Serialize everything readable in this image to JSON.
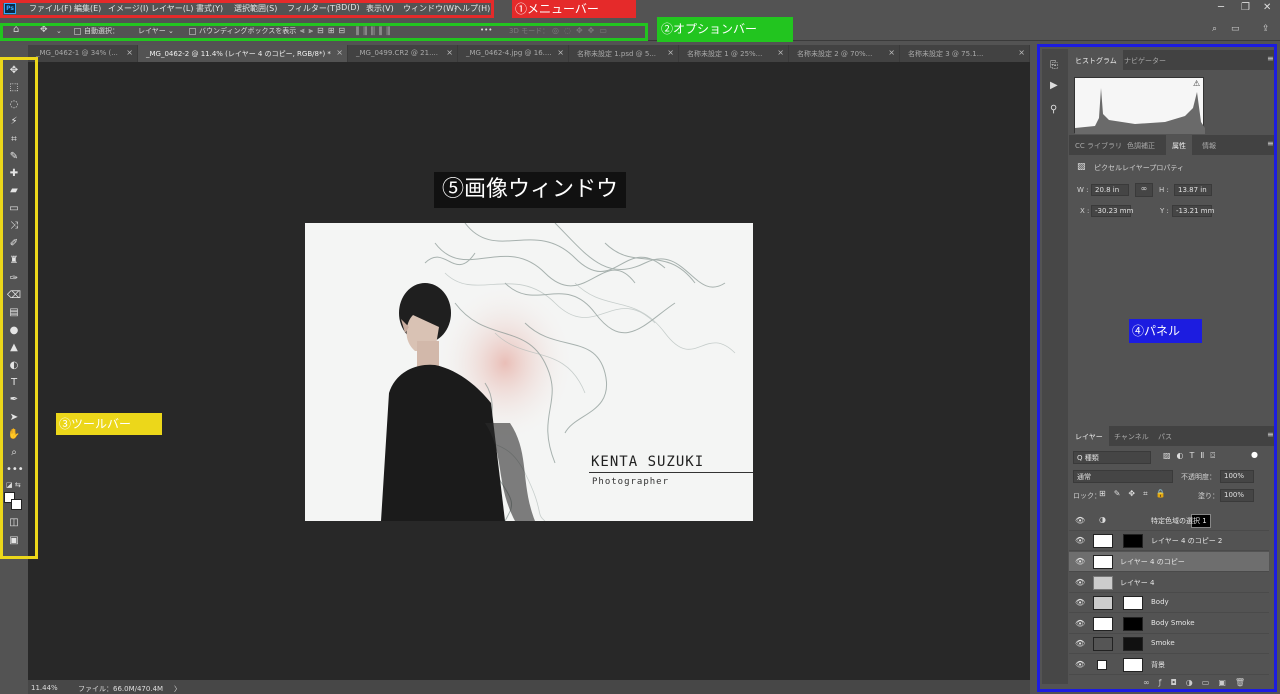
{
  "app_logo": "Ps",
  "menu": [
    "ファイル(F)",
    "編集(E)",
    "イメージ(I)",
    "レイヤー(L)",
    "書式(Y)",
    "選択範囲(S)",
    "フィルター(T)",
    "3D(D)",
    "表示(V)",
    "ウィンドウ(W)",
    "ヘルプ(H)"
  ],
  "window_controls": {
    "minimize": "─",
    "restore": "❐",
    "close": "✕"
  },
  "annotations": {
    "menu_bar": "①メニューバー",
    "option_bar": "②オプションバー",
    "toolbar": "③ツールバー",
    "panel": "④パネル",
    "image_window": "⑤画像ウィンドウ"
  },
  "annotation_colors": {
    "menu_bar": "#e52a2a",
    "option_bar": "#22c51f",
    "toolbar": "#ecd71a",
    "panel": "#1c1ce0"
  },
  "options": {
    "auto_select": "自動選択：",
    "layer_select": "レイヤー",
    "bounding_box": "バウンディングボックスを表示",
    "more": "•••",
    "mode_3d": "3D モード："
  },
  "tabs": [
    {
      "label": "_MG_0462-1 @ 34% (...",
      "close": "×",
      "active": false
    },
    {
      "label": "_MG_0462-2 @ 11.4% (レイヤー 4 のコピー, RGB/8*) *",
      "close": "×",
      "active": true
    },
    {
      "label": "_MG_0499.CR2 @ 21....",
      "close": "×",
      "active": false
    },
    {
      "label": "_MG_0462-4.jpg @ 16....",
      "close": "×",
      "active": false
    },
    {
      "label": "名称未設定 1.psd @ 5...",
      "close": "×",
      "active": false
    },
    {
      "label": "名称未設定 1 @ 25%...",
      "close": "×",
      "active": false
    },
    {
      "label": "名称未設定 2 @ 70%...",
      "close": "×",
      "active": false
    },
    {
      "label": "名称未設定 3 @ 75.1...",
      "close": "×",
      "active": false
    }
  ],
  "photo": {
    "name": "KENTA SUZUKI",
    "role": "Photographer"
  },
  "status": {
    "zoom": "11.44%",
    "file": "ファイル：66.0M/470.4M",
    "arrow": "〉"
  },
  "tools": [
    "move-tool-icon",
    "marquee-tool-icon",
    "lasso-tool-icon",
    "magic-wand-icon",
    "crop-tool-icon",
    "eyedropper-icon",
    "healing-brush-icon",
    "brush-icon",
    "patch-icon",
    "content-aware-move-icon",
    "pencil-icon",
    "clone-stamp-icon",
    "history-brush-icon",
    "eraser-icon",
    "gradient-icon",
    "blur-icon",
    "sharpen-icon",
    "dodge-icon",
    "type-tool-icon",
    "pen-tool-icon",
    "path-select-icon",
    "hand-tool-icon",
    "zoom-tool-icon",
    "more-tools-icon"
  ],
  "panels": {
    "top_tabs": [
      "ヒストグラム",
      "ナビゲーター"
    ],
    "mid_tabs": [
      "CC ライブラリ",
      "色調補正",
      "属性",
      "情報"
    ],
    "props_title": "ピクセルレイヤープロパティ",
    "w_label": "W :",
    "w": "20.8 in",
    "h_label": "H :",
    "h": "13.87 in",
    "x_label": "X :",
    "x": "-30.23 mm",
    "y_label": "Y :",
    "y": "-13.21 mm",
    "layer_tabs": [
      "レイヤー",
      "チャンネル",
      "パス"
    ],
    "kind": "Q 種類",
    "blend": "通常",
    "opacity_label": "不透明度：",
    "opacity": "100%",
    "lock_label": "ロック：",
    "fill_label": "塗り：",
    "fill": "100%",
    "layers": [
      {
        "name": "特定色域の選択 1",
        "selected": false
      },
      {
        "name": "レイヤー 4 のコピー 2",
        "selected": false
      },
      {
        "name": "レイヤー 4 のコピー",
        "selected": true
      },
      {
        "name": "レイヤー 4",
        "selected": false
      },
      {
        "name": "Body",
        "selected": false
      },
      {
        "name": "Body Smoke",
        "selected": false
      },
      {
        "name": "Smoke",
        "selected": false
      },
      {
        "name": "背景",
        "selected": false
      }
    ],
    "footer_icons": [
      "link-icon",
      "fx-icon",
      "mask-icon",
      "adjustment-icon",
      "group-icon",
      "new-layer-icon",
      "trash-icon"
    ]
  }
}
